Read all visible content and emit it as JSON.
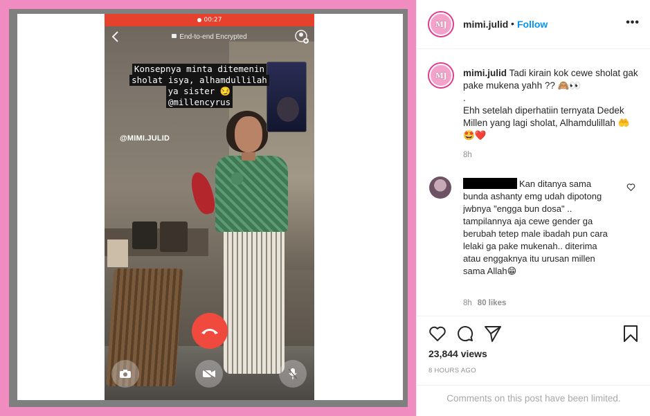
{
  "media": {
    "recording_time": "00:27",
    "call_status": "End-to-end Encrypted",
    "overlay_caption_lines": [
      "Konsepnya minta ditemenin",
      "sholat isya, alhamdullilah",
      "ya sister 😏",
      "@millencyrus"
    ],
    "overlay_handle": "@MIMI.JULID",
    "colors": {
      "frame_pink": "#f08cc0",
      "end_call": "#f04a3f",
      "rec_bar": "#e5412c"
    }
  },
  "header": {
    "avatar_text": "MJ",
    "username": "mimi.julid",
    "separator": "•",
    "follow_label": "Follow",
    "more_label": "•••"
  },
  "caption": {
    "avatar_text": "MJ",
    "username": "mimi.julid",
    "line1": "Tadi kirain kok cewe sholat gak pake mukena yahh ?? 🙈👀",
    "dot": ".",
    "line2": "Ehh setelah diperhatiin ternyata Dedek Millen yang lagi sholat, Alhamdulillah 🤲🤩❤️",
    "time": "8h"
  },
  "comment": {
    "text": "Kan ditanya sama bunda ashanty emg udah dipotong jwbnya \"engga bun dosa\" .. tampilannya aja cewe gender ga berubah tetep male ibadah pun cara lelaki ga pake mukenah.. diterima atau enggaknya itu urusan millen sama Allah😁",
    "time": "8h",
    "likes": "80 likes"
  },
  "stats": {
    "views": "23,844 views",
    "posted": "8 HOURS AGO"
  },
  "footer": {
    "comments_limited": "Comments on this post have been limited."
  }
}
